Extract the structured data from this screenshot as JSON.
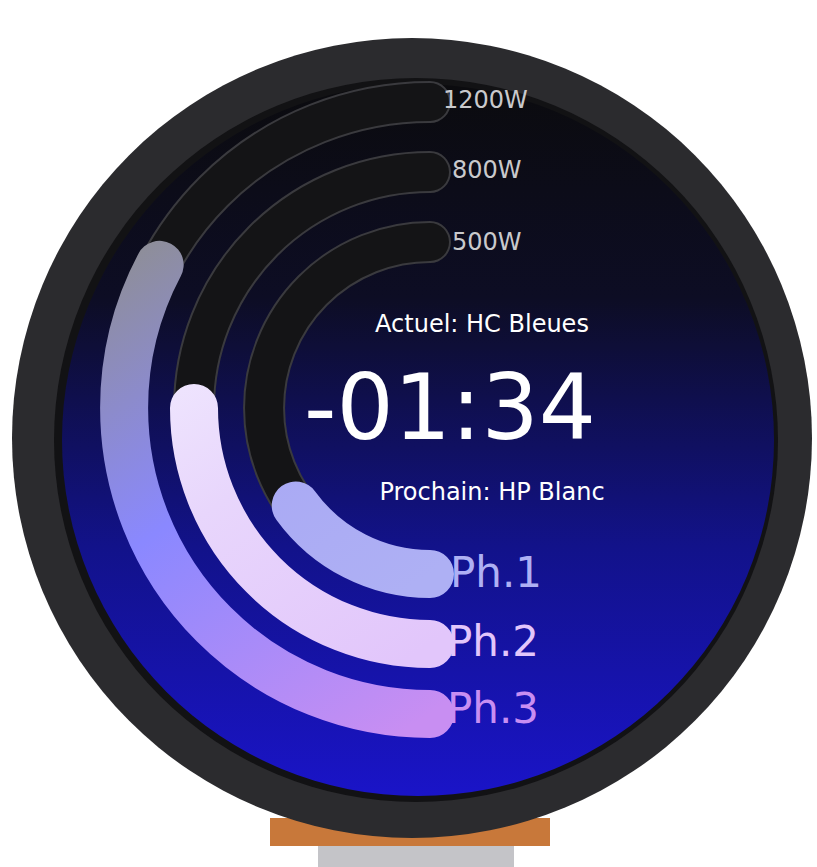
{
  "scale_labels": [
    "1200W",
    "800W",
    "500W"
  ],
  "current_period": "Actuel: HC Bleues",
  "countdown": "-01:34",
  "next_period": "Prochain: HP Blanc",
  "phases": [
    {
      "label": "Ph.1",
      "level": 0.3,
      "color": "#aeb0f4"
    },
    {
      "label": "Ph.2",
      "level": 0.5,
      "color": "#e2c6fb"
    },
    {
      "label": "Ph.3",
      "level": 0.655,
      "color": "#c88ef2"
    }
  ]
}
